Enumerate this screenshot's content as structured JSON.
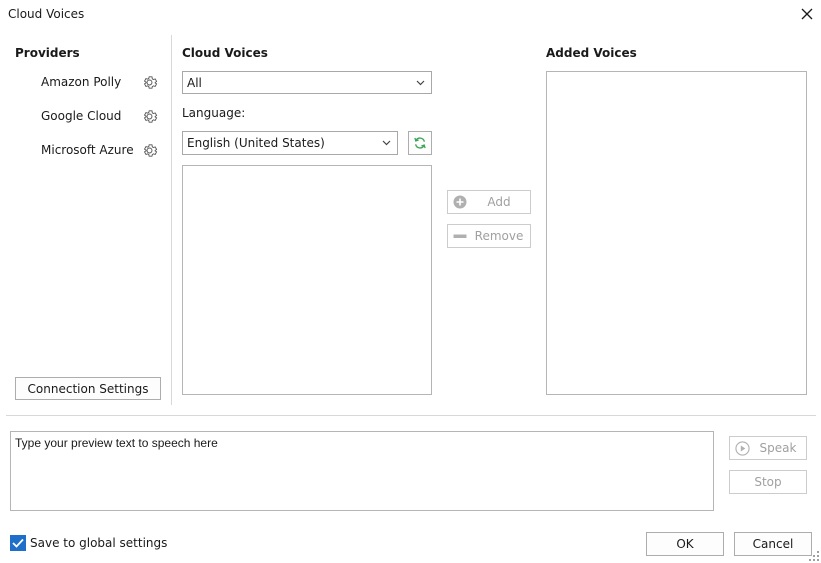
{
  "window": {
    "title": "Cloud Voices"
  },
  "providers": {
    "heading": "Providers",
    "items": [
      {
        "label": "Amazon Polly",
        "icon": "gear-icon"
      },
      {
        "label": "Google Cloud",
        "icon": "gear-icon"
      },
      {
        "label": "Microsoft Azure",
        "icon": "gear-icon"
      }
    ],
    "connection_settings_label": "Connection Settings"
  },
  "cloud_voices": {
    "heading": "Cloud Voices",
    "filter_value": "All",
    "language_label": "Language:",
    "language_value": "English (United States)"
  },
  "actions": {
    "add_label": "Add",
    "remove_label": "Remove"
  },
  "added_voices": {
    "heading": "Added Voices"
  },
  "preview": {
    "placeholder": "Type your preview text to speech here"
  },
  "playback": {
    "speak_label": "Speak",
    "stop_label": "Stop"
  },
  "footer": {
    "save_global_label": "Save to global settings",
    "save_global_checked": true,
    "ok_label": "OK",
    "cancel_label": "Cancel"
  },
  "colors": {
    "accent": "#1e6fc9",
    "refresh_green": "#3aa655",
    "disabled_text": "#a0a0a0"
  }
}
